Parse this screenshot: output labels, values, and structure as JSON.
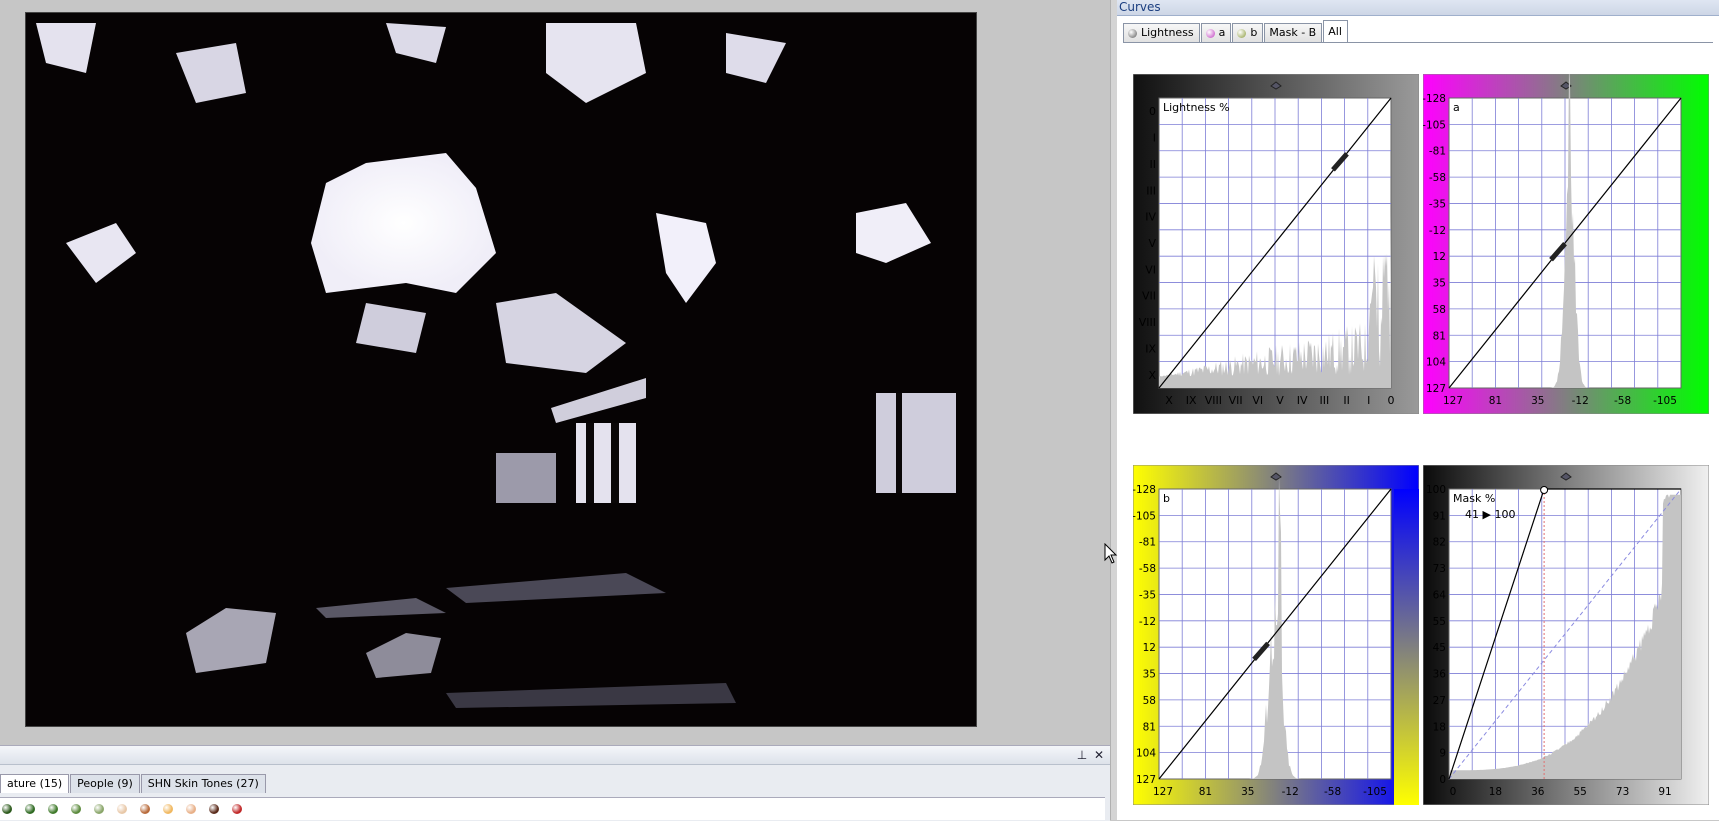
{
  "panel": {
    "title": "Curves"
  },
  "curve_tabs": [
    {
      "label": "Lightness",
      "icon": "lightness-tab-icon",
      "color": "#5a5a5a"
    },
    {
      "label": "a",
      "icon": "a-channel-tab-icon",
      "color": "#c03cc0"
    },
    {
      "label": "b",
      "icon": "b-channel-tab-icon",
      "color": "#8a9a3a"
    },
    {
      "label": "Mask - B",
      "icon": "",
      "color": ""
    },
    {
      "label": "All",
      "icon": "",
      "color": "",
      "active": true
    }
  ],
  "bottom_panel": {
    "pin_icon": "pin-icon",
    "close_icon": "close-icon",
    "tabs": [
      {
        "label": "ature (15)",
        "active": true
      },
      {
        "label": "People (9)"
      },
      {
        "label": "SHN Skin Tones (27)"
      }
    ],
    "swatch_colors": [
      "#2c5a1c",
      "#2f6a22",
      "#3f7a2a",
      "#5b8a3c",
      "#8aa66a",
      "#e8c8a8",
      "#b86a3a",
      "#f0b860",
      "#e8b088",
      "#5a2a1a",
      "#c02828"
    ]
  },
  "charts": {
    "lightness": {
      "label": "Lightness %",
      "y_ticks": [
        "0",
        "I",
        "II",
        "III",
        "IV",
        "V",
        "VI",
        "VII",
        "VIII",
        "IX",
        "X"
      ],
      "x_ticks": [
        "X",
        "IX",
        "VIII",
        "VII",
        "VI",
        "V",
        "IV",
        "III",
        "II",
        "I",
        "0"
      ],
      "gradient": [
        "#101010",
        "#9a9a9a"
      ],
      "point": [
        0.78,
        0.78
      ]
    },
    "a": {
      "label": "a",
      "y_ticks": [
        "-128",
        "-105",
        "-81",
        "-58",
        "-35",
        "-12",
        "12",
        "35",
        "58",
        "81",
        "104",
        "127"
      ],
      "x_ticks": [
        "127",
        "81",
        "35",
        "-12",
        "-58",
        "-105"
      ],
      "gradient": [
        "#ff00ff",
        "#00ff00"
      ],
      "point": [
        0.47,
        0.47
      ]
    },
    "b": {
      "label": "b",
      "y_ticks": [
        "-128",
        "-105",
        "-81",
        "-58",
        "-35",
        "-12",
        "12",
        "35",
        "58",
        "81",
        "104",
        "127"
      ],
      "x_ticks": [
        "127",
        "81",
        "35",
        "-12",
        "-58",
        "-105"
      ],
      "gradient": [
        "#ffff00",
        "#0000ff"
      ],
      "point": [
        0.44,
        0.44
      ]
    },
    "mask": {
      "label": "Mask %",
      "readout": "41 ▶ 100",
      "y_ticks": [
        "100",
        "91",
        "82",
        "73",
        "64",
        "55",
        "45",
        "36",
        "27",
        "18",
        "9",
        "0"
      ],
      "x_ticks": [
        "0",
        "18",
        "36",
        "55",
        "73",
        "91"
      ],
      "gradient": [
        "#0a0a0a",
        "#f0f0f0"
      ],
      "point": [
        0.41,
        1.0
      ]
    }
  }
}
